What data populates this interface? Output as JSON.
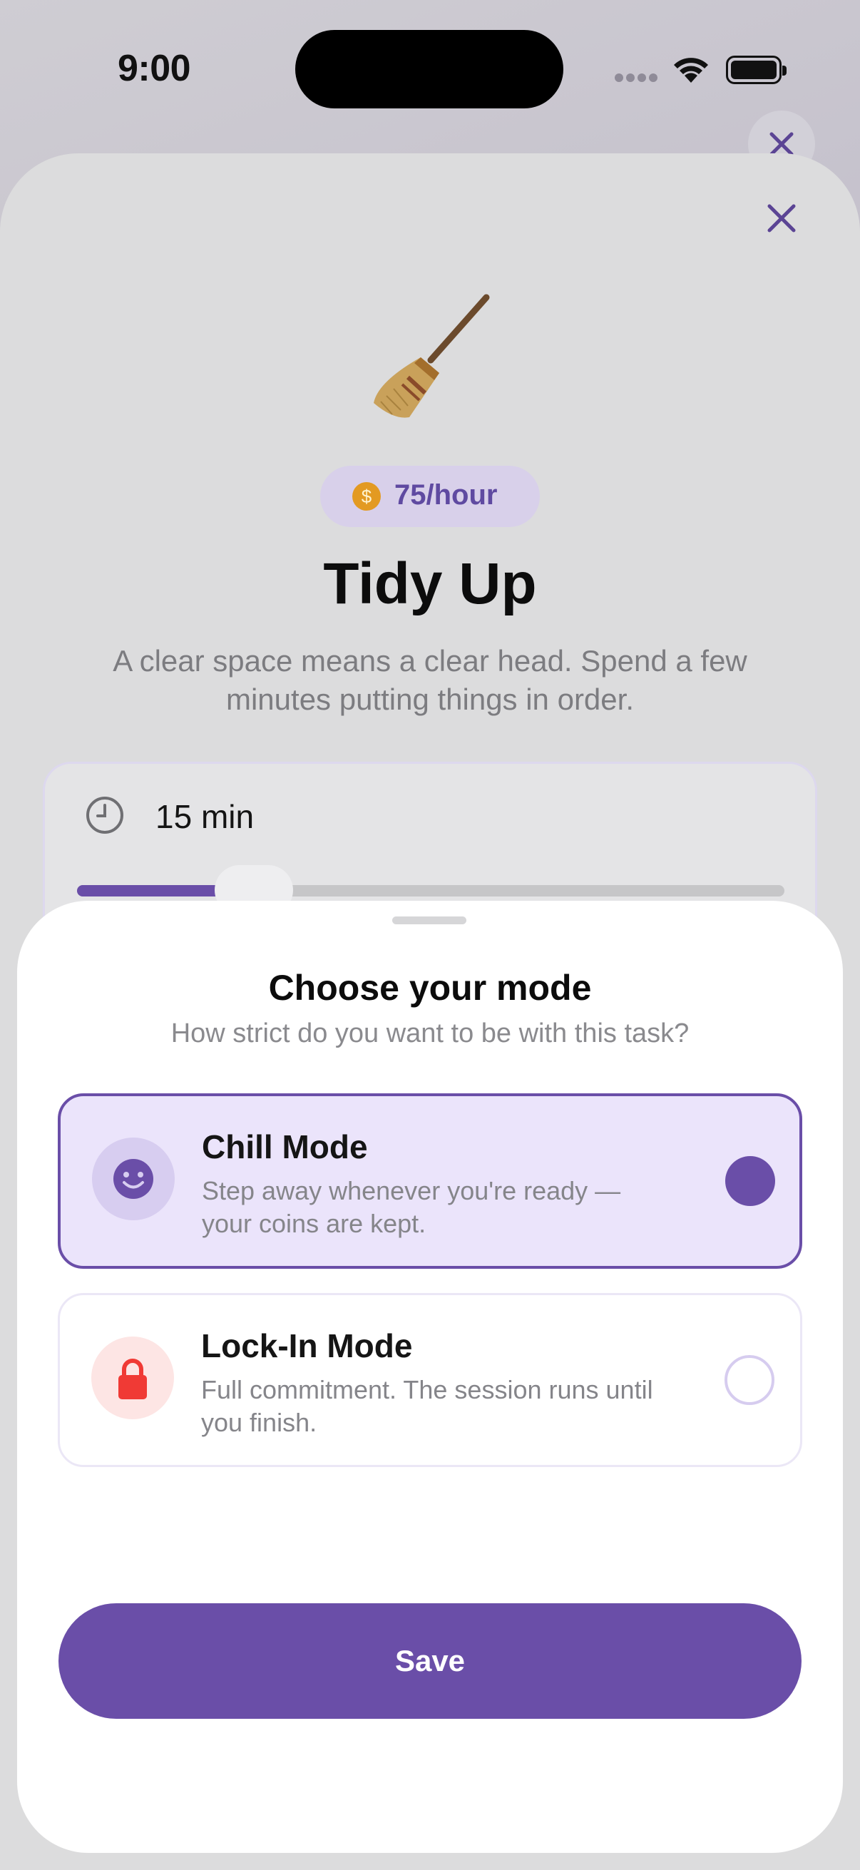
{
  "status_bar": {
    "time": "9:00"
  },
  "task": {
    "icon": "broom-icon",
    "rate": "75/hour",
    "title": "Tidy Up",
    "description": "A clear space means a clear head. Spend a few minutes putting things in order.",
    "duration": "15 min",
    "duration_slider_fraction": 0.22
  },
  "sheet": {
    "title": "Choose your mode",
    "subtitle": "How strict do you want to be with this task?",
    "options": [
      {
        "title": "Chill Mode",
        "description": "Step away whenever you're ready — your coins are kept.",
        "icon": "smiley-icon",
        "selected": true
      },
      {
        "title": "Lock-In Mode",
        "description": "Full commitment. The session runs until you finish.",
        "icon": "lock-icon",
        "selected": false
      }
    ],
    "save_label": "Save"
  },
  "colors": {
    "accent": "#6a4ea8",
    "accent_light": "#ebe4fb",
    "coin": "#e39a22",
    "lock_red": "#f03a35"
  }
}
